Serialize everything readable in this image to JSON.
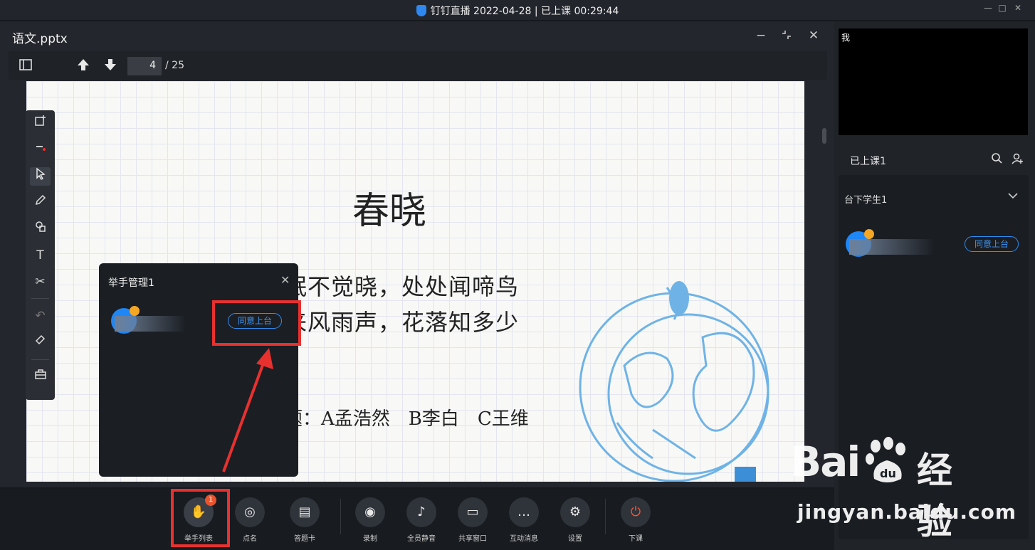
{
  "window": {
    "title": "钉钉直播 2022-04-28 | 已上课 00:29:44",
    "min_icon": "—",
    "max_icon": "□",
    "close_icon": "✕"
  },
  "document": {
    "filename": "语文.pptx",
    "current_page": "4",
    "total_pages": "/ 25"
  },
  "slide": {
    "title": "春晓",
    "line1": "眠不觉晓，处处闻啼鸟",
    "line2": "来风雨声，花落知多少",
    "question": "题：A孟浩然　B李白　C王维",
    "globe_color": "#6fb3e6"
  },
  "tools": [
    "add-page",
    "laser",
    "select",
    "pen",
    "shapes",
    "text",
    "cut",
    "undo",
    "eraser",
    "toolbox"
  ],
  "hand_raise_popup": {
    "title": "举手管理1",
    "agree_label": "同意上台"
  },
  "toolbar": {
    "items": [
      {
        "label": "举手列表",
        "icon": "hand-icon",
        "badge": "1"
      },
      {
        "label": "点名",
        "icon": "roll-call-icon"
      },
      {
        "label": "答题卡",
        "icon": "answer-card-icon"
      },
      {
        "label": "录制",
        "icon": "record-icon"
      },
      {
        "label": "全员静音",
        "icon": "mute-all-icon"
      },
      {
        "label": "共享窗口",
        "icon": "share-window-icon"
      },
      {
        "label": "互动消息",
        "icon": "message-icon"
      },
      {
        "label": "设置",
        "icon": "settings-icon"
      },
      {
        "label": "下课",
        "icon": "power-icon"
      }
    ],
    "end_color": "#f25a3b"
  },
  "right_panel": {
    "video_label": "我",
    "class_count": "已上课1",
    "students_header": "台下学生1",
    "agree_label": "同意上台"
  },
  "watermark": {
    "brand": "Bai",
    "brand_cn": "经验",
    "url": "jingyan.baidu.com"
  },
  "colors": {
    "accent": "#2f8ef5",
    "highlight": "#e8312f",
    "avatar": "#1f86f5"
  }
}
